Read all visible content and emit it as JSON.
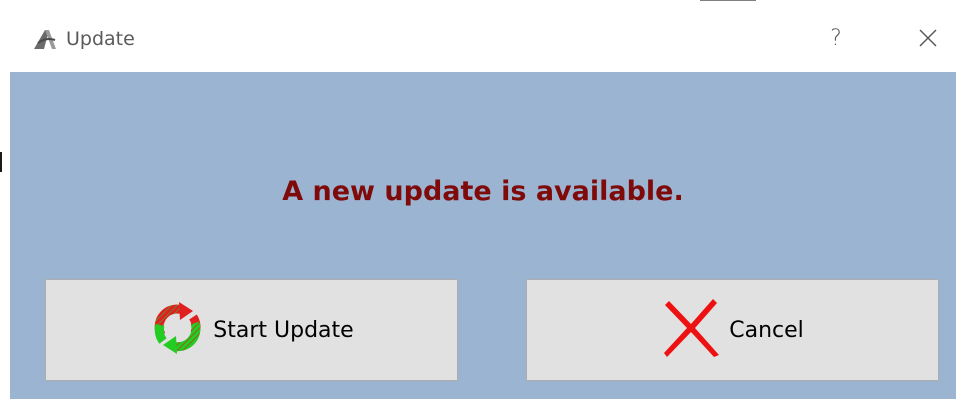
{
  "window": {
    "title": "Update",
    "help_label": "?",
    "close_icon": "close-icon",
    "app_icon": "app-logo-icon"
  },
  "dialog": {
    "message": "A new update is available.",
    "message_color": "#7f0a0a",
    "background_color": "#9bb4d1"
  },
  "buttons": {
    "start_update": {
      "label": "Start Update",
      "icon": "refresh-arrows-icon"
    },
    "cancel": {
      "label": "Cancel",
      "icon": "red-x-icon"
    }
  }
}
